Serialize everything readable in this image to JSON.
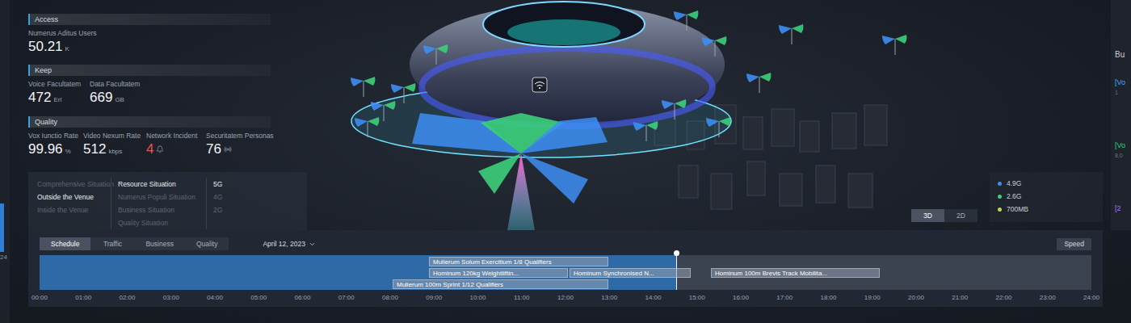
{
  "left_edge": {
    "label": "24"
  },
  "left_panel": {
    "sections": [
      {
        "title": "Access",
        "metrics": [
          {
            "label": "Numerus Aditus Users",
            "value": "50.21",
            "unit": "K",
            "kind": "unit",
            "alert": false
          }
        ]
      },
      {
        "title": "Keep",
        "metrics": [
          {
            "label": "Voice Facultatem",
            "value": "472",
            "unit": "Erl",
            "kind": "unit",
            "alert": false
          },
          {
            "label": "Data Facultatem",
            "value": "669",
            "unit": "GB",
            "kind": "unit",
            "alert": false
          }
        ]
      },
      {
        "title": "Quality",
        "metrics": [
          {
            "label": "Vox Iunctio Rate",
            "value": "99.96",
            "unit": "%",
            "kind": "unit",
            "alert": false
          },
          {
            "label": "Video Nexum Rate",
            "value": "512",
            "unit": "kbps",
            "kind": "unit",
            "alert": false
          },
          {
            "label": "Network Incident",
            "value": "4",
            "unit": "",
            "kind": "alert",
            "alert": true
          },
          {
            "label": "Securitatem Personas",
            "value": "76",
            "unit": "",
            "kind": "status",
            "alert": false
          }
        ]
      }
    ],
    "menu": [
      {
        "items": [
          {
            "label": "Comprehensive Situation",
            "selected": false
          },
          {
            "label": "Outside the Venue",
            "selected": true
          },
          {
            "label": "Inside the Venue",
            "selected": false
          }
        ]
      },
      {
        "items": [
          {
            "label": "Resource Situation",
            "selected": true
          },
          {
            "label": "Numerus Populi Situation",
            "selected": false
          },
          {
            "label": "Business Situation",
            "selected": false
          },
          {
            "label": "Quality Situation",
            "selected": false
          }
        ]
      },
      {
        "items": [
          {
            "label": "5G",
            "selected": true
          },
          {
            "label": "4G",
            "selected": false
          },
          {
            "label": "2G",
            "selected": false
          }
        ]
      }
    ]
  },
  "legend": [
    {
      "label": "4.9G",
      "color": "#3d8ef5"
    },
    {
      "label": "2.6G",
      "color": "#3ccf7a"
    },
    {
      "label": "700MB",
      "color": "#b8d94a"
    }
  ],
  "view_toggle": [
    {
      "label": "3D",
      "selected": true
    },
    {
      "label": "2D",
      "selected": false
    }
  ],
  "right_edge": {
    "title": "Bu",
    "items": [
      {
        "label": "[Vo",
        "color": "#4aa3ff",
        "sub": "1"
      },
      {
        "label": "[Vo",
        "color": "#3ccf7a",
        "sub": "8,0"
      },
      {
        "label": "[2",
        "color": "#a07cf0",
        "sub": ""
      }
    ]
  },
  "timeline": {
    "tabs": [
      {
        "label": "Schedule",
        "selected": true
      },
      {
        "label": "Traffic",
        "selected": false
      },
      {
        "label": "Business",
        "selected": false
      },
      {
        "label": "Quality",
        "selected": false
      }
    ],
    "date": "April 12, 2023",
    "speed": "Speed",
    "level": 0.605,
    "axis": [
      "00:00",
      "01:00",
      "02:00",
      "03:00",
      "04:00",
      "05:00",
      "06:00",
      "07:00",
      "08:00",
      "09:00",
      "10:00",
      "11:00",
      "12:00",
      "13:00",
      "14:00",
      "15:00",
      "16:00",
      "17:00",
      "18:00",
      "19:00",
      "20:00",
      "21:00",
      "22:00",
      "23:00",
      "24:00"
    ],
    "events": [
      {
        "label": "Mulierum Solum Exercitium 1/8 Qualifiers",
        "start": 8.885,
        "end": 12.977,
        "lane": 0
      },
      {
        "label": "Hominum 120kg Weightliftin...",
        "start": 8.885,
        "end": 12.055,
        "lane": 1
      },
      {
        "label": "Hominum Synchronised N...",
        "start": 12.092,
        "end": 14.857,
        "lane": 1
      },
      {
        "label": "Hominum 100m Brevis Track Mobilita...",
        "start": 15.318,
        "end": 19.17,
        "lane": 1
      },
      {
        "label": "Mulierum 100m Sprint 1/12 Qualifiers",
        "start": 8.055,
        "end": 12.977,
        "lane": 2
      }
    ]
  }
}
